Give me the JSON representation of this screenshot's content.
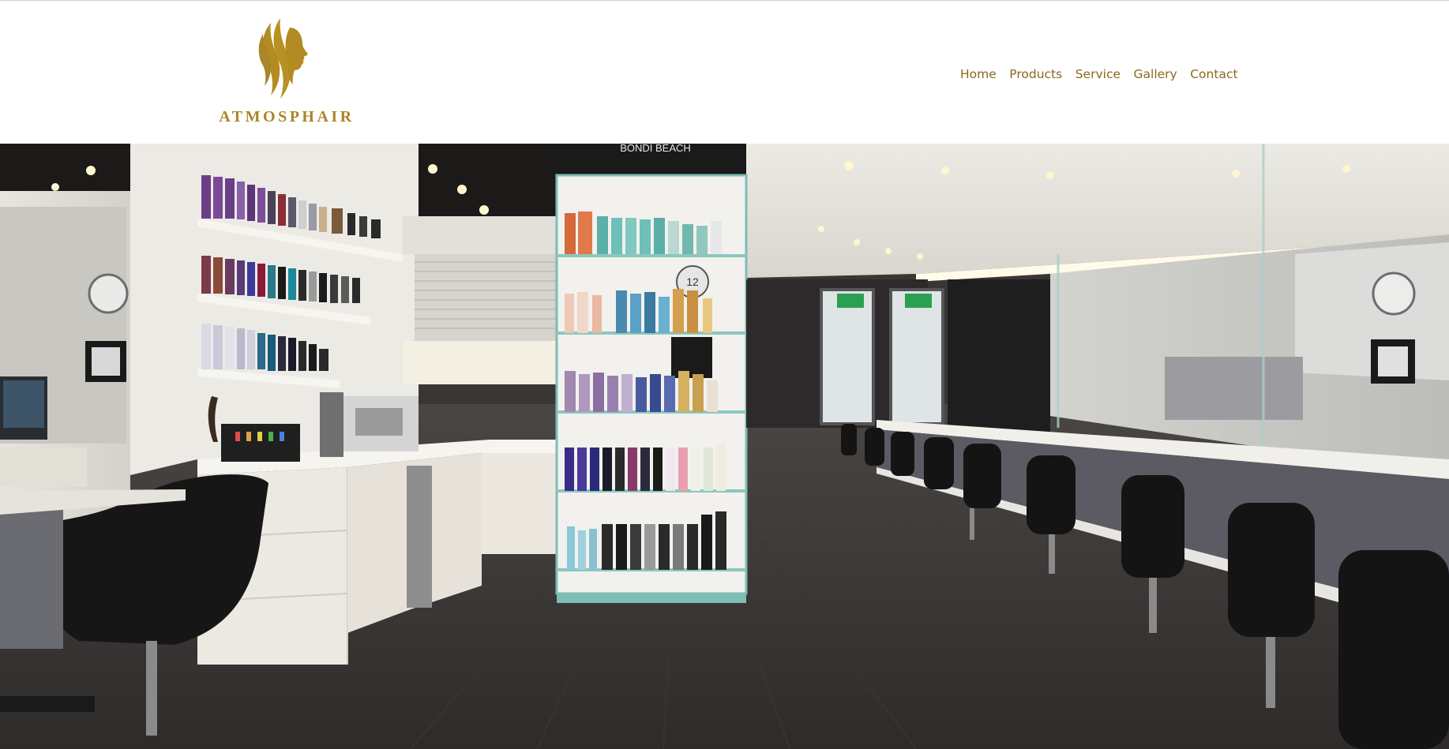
{
  "brand": {
    "name": "ATMOSPHAIR",
    "logo_icon": "woman-profile-hair-icon",
    "color": "#a9862a"
  },
  "nav": {
    "items": [
      {
        "label": "Home"
      },
      {
        "label": "Products"
      },
      {
        "label": "Service"
      },
      {
        "label": "Gallery"
      },
      {
        "label": "Contact"
      }
    ],
    "color": "#8a6a1e"
  },
  "hero": {
    "sign_text": "BONDI BEACH",
    "clock_text": "12"
  }
}
